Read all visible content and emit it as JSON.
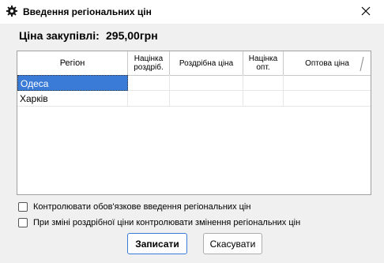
{
  "window": {
    "title": "Введення регіональних цін",
    "title_icon": "gear-icon",
    "close_icon": "close-icon"
  },
  "purchase_price": {
    "label": "Ціна закупівлі:",
    "value": "295,00грн"
  },
  "table": {
    "columns": [
      "Регіон",
      "Націнка роздріб.",
      "Роздрібна ціна",
      "Націнка опт.",
      "Оптова ціна"
    ],
    "rows": [
      [
        "Одеса",
        "",
        "",
        "",
        ""
      ],
      [
        "Харків",
        "",
        "",
        "",
        ""
      ]
    ],
    "selected_row": 0,
    "selection_color": "#3b7bd8"
  },
  "checkboxes": [
    {
      "label": "Контролювати обов'язкове введення регіональних цін",
      "checked": false
    },
    {
      "label": "При зміні роздрібної ціни контролювати змінення регіональних цін",
      "checked": false
    }
  ],
  "buttons": {
    "save": "Записати",
    "cancel": "Скасувати"
  }
}
